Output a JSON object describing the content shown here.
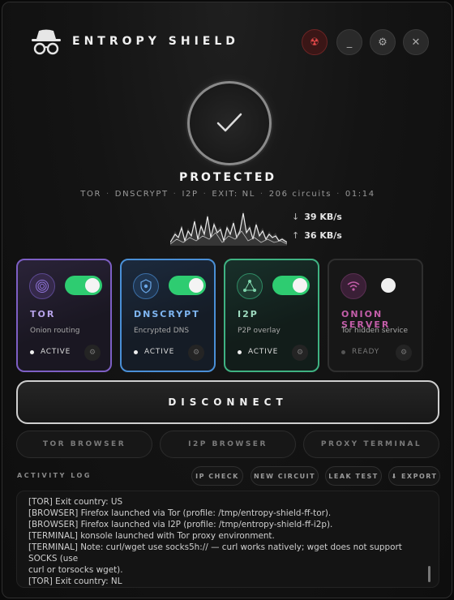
{
  "app": {
    "title": "ENTROPY SHIELD"
  },
  "header": {
    "buttons": [
      {
        "icon": "radiation-icon",
        "glyph": "☢"
      },
      {
        "icon": "minimize-icon",
        "glyph": "_"
      },
      {
        "icon": "settings-icon",
        "glyph": "⚙"
      },
      {
        "icon": "close-icon",
        "glyph": "✕"
      }
    ]
  },
  "status": {
    "label": "PROTECTED",
    "summary": {
      "tor": "TOR",
      "dns": "DNSCRYPT",
      "i2p": "I2P",
      "exit": "EXIT: NL",
      "circuits": "206 circuits",
      "time": "01:14"
    },
    "download": "39 KB/s",
    "upload": "36 KB/s",
    "download_arrow": "↓",
    "upload_arrow": "↑"
  },
  "modules": [
    {
      "name": "TOR",
      "desc": "Onion routing",
      "state": "ACTIVE",
      "enabled": true,
      "color": "#7d5fc4"
    },
    {
      "name": "DNSCRYPT",
      "desc": "Encrypted DNS",
      "state": "ACTIVE",
      "enabled": true,
      "color": "#4a8fd6"
    },
    {
      "name": "I2P",
      "desc": "P2P overlay",
      "state": "ACTIVE",
      "enabled": true,
      "color": "#3fb282"
    },
    {
      "name": "ONION SERVER",
      "desc": "Tor hidden service",
      "state": "READY",
      "enabled": false,
      "color": "#c35ea9"
    }
  ],
  "actions": {
    "disconnect": "DISCONNECT",
    "tor_browser": "TOR BROWSER",
    "i2p_browser": "I2P BROWSER",
    "proxy_terminal": "PROXY TERMINAL"
  },
  "log": {
    "label": "ACTIVITY LOG",
    "buttons": {
      "ip_check": "IP CHECK",
      "new_circuit": "NEW CIRCUIT",
      "leak_test": "LEAK TEST",
      "export": "⬇ EXPORT"
    },
    "lines": [
      "[TOR] Exit country: US",
      "[BROWSER] Firefox launched via Tor (profile: /tmp/entropy-shield-ff-tor).",
      "[BROWSER] Firefox launched via I2P (profile: /tmp/entropy-shield-ff-i2p).",
      "[TERMINAL] konsole launched with Tor proxy environment.",
      "[TERMINAL] Note: curl/wget use socks5h:// — curl works natively; wget does not support SOCKS (use",
      "curl or torsocks wget).",
      "[TOR] Exit country: NL"
    ]
  },
  "colors": {
    "active_toggle": "#2ecc71",
    "danger": "#e04848"
  }
}
